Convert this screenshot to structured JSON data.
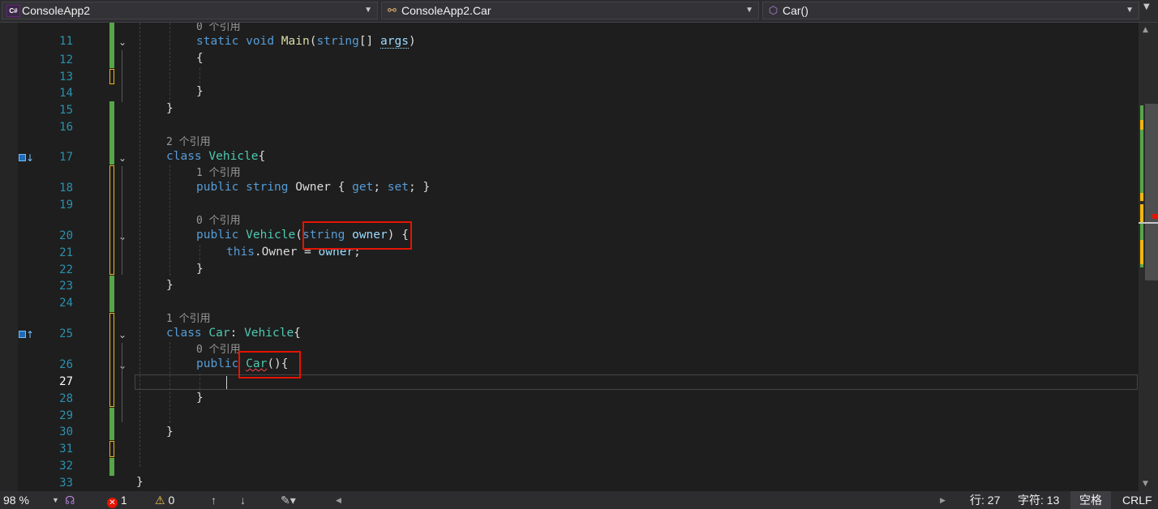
{
  "navbar": {
    "project": "ConsoleApp2",
    "project_icon": "C#",
    "type": "ConsoleApp2.Car",
    "member": "Car()"
  },
  "editor": {
    "lines": [
      {
        "n": "11",
        "lens": "0 个引用"
      },
      {
        "n": "12"
      },
      {
        "n": "13"
      },
      {
        "n": "14"
      },
      {
        "n": "15"
      },
      {
        "n": "16"
      },
      {
        "n": "17",
        "lens": "2 个引用"
      },
      {
        "n": "18",
        "lens": "1 个引用"
      },
      {
        "n": "19"
      },
      {
        "n": "20",
        "lens": "0 个引用"
      },
      {
        "n": "21"
      },
      {
        "n": "22"
      },
      {
        "n": "23"
      },
      {
        "n": "24"
      },
      {
        "n": "25",
        "lens": "1 个引用"
      },
      {
        "n": "26",
        "lens": "0 个引用"
      },
      {
        "n": "27"
      },
      {
        "n": "28"
      },
      {
        "n": "29"
      },
      {
        "n": "30"
      },
      {
        "n": "31"
      },
      {
        "n": "32"
      },
      {
        "n": "33"
      }
    ],
    "tokens": {
      "static": "static",
      "void": "void",
      "main": "Main",
      "lparen": "(",
      "string": "string",
      "arr": "[] ",
      "args": "args",
      "rparen": ")",
      "lbrace": "{",
      "rbrace": "}",
      "class": "class",
      "vehicle": "Vehicle",
      "public": "public",
      "owner_prop": "Owner",
      "get": "get",
      "set": "set",
      "semi": ";",
      "space": " ",
      "owner_param": "owner",
      "this": "this",
      "dot": ".",
      "eq": " = ",
      "car": "Car",
      "colon": ": ",
      "paren_brace": "(){"
    }
  },
  "statusbar": {
    "zoom": "98 %",
    "errors": "1",
    "warnings": "0",
    "line": "行: 27",
    "char": "字符: 13",
    "spacing": "空格",
    "eol": "CRLF"
  },
  "colors": {
    "keyword": "#569cd6",
    "type": "#4ec9b0",
    "method": "#dcdcaa",
    "param": "#9cdcfe",
    "text": "#dcdcdc",
    "linenum": "#2b91af",
    "saved_change": "#57a64a",
    "unsaved_change": "#efb810",
    "highlight_box": "#e51400"
  }
}
